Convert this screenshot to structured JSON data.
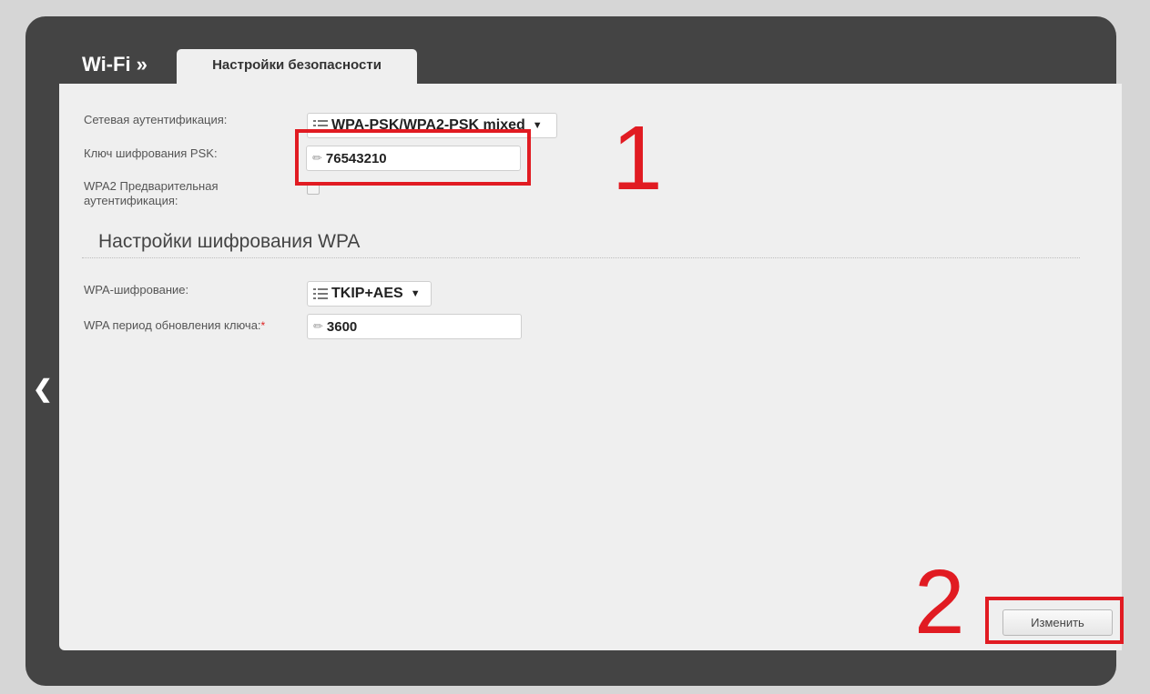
{
  "header": {
    "breadcrumb": "Wi-Fi »",
    "tab_label": "Настройки безопасности",
    "back_icon": "chevron-left-icon"
  },
  "form": {
    "auth_label": "Сетевая аутентификация:",
    "auth_value": "WPA-PSK/WPA2-PSK mixed",
    "psk_label": "Ключ шифрования PSK:",
    "psk_value": "76543210",
    "preauth_label_line1": "WPA2 Предварительная",
    "preauth_label_line2": "аутентификация:",
    "preauth_checked": false
  },
  "wpa_section": {
    "title": "Настройки шифрования WPA",
    "encryption_label": "WPA-шифрование:",
    "encryption_value": "TKIP+AES",
    "renewal_label": "WPA период обновления ключа:",
    "renewal_required_mark": "*",
    "renewal_value": "3600"
  },
  "annotations": {
    "marker1": "1",
    "marker2": "2",
    "color": "#e11b22"
  },
  "actions": {
    "apply_label": "Изменить"
  }
}
